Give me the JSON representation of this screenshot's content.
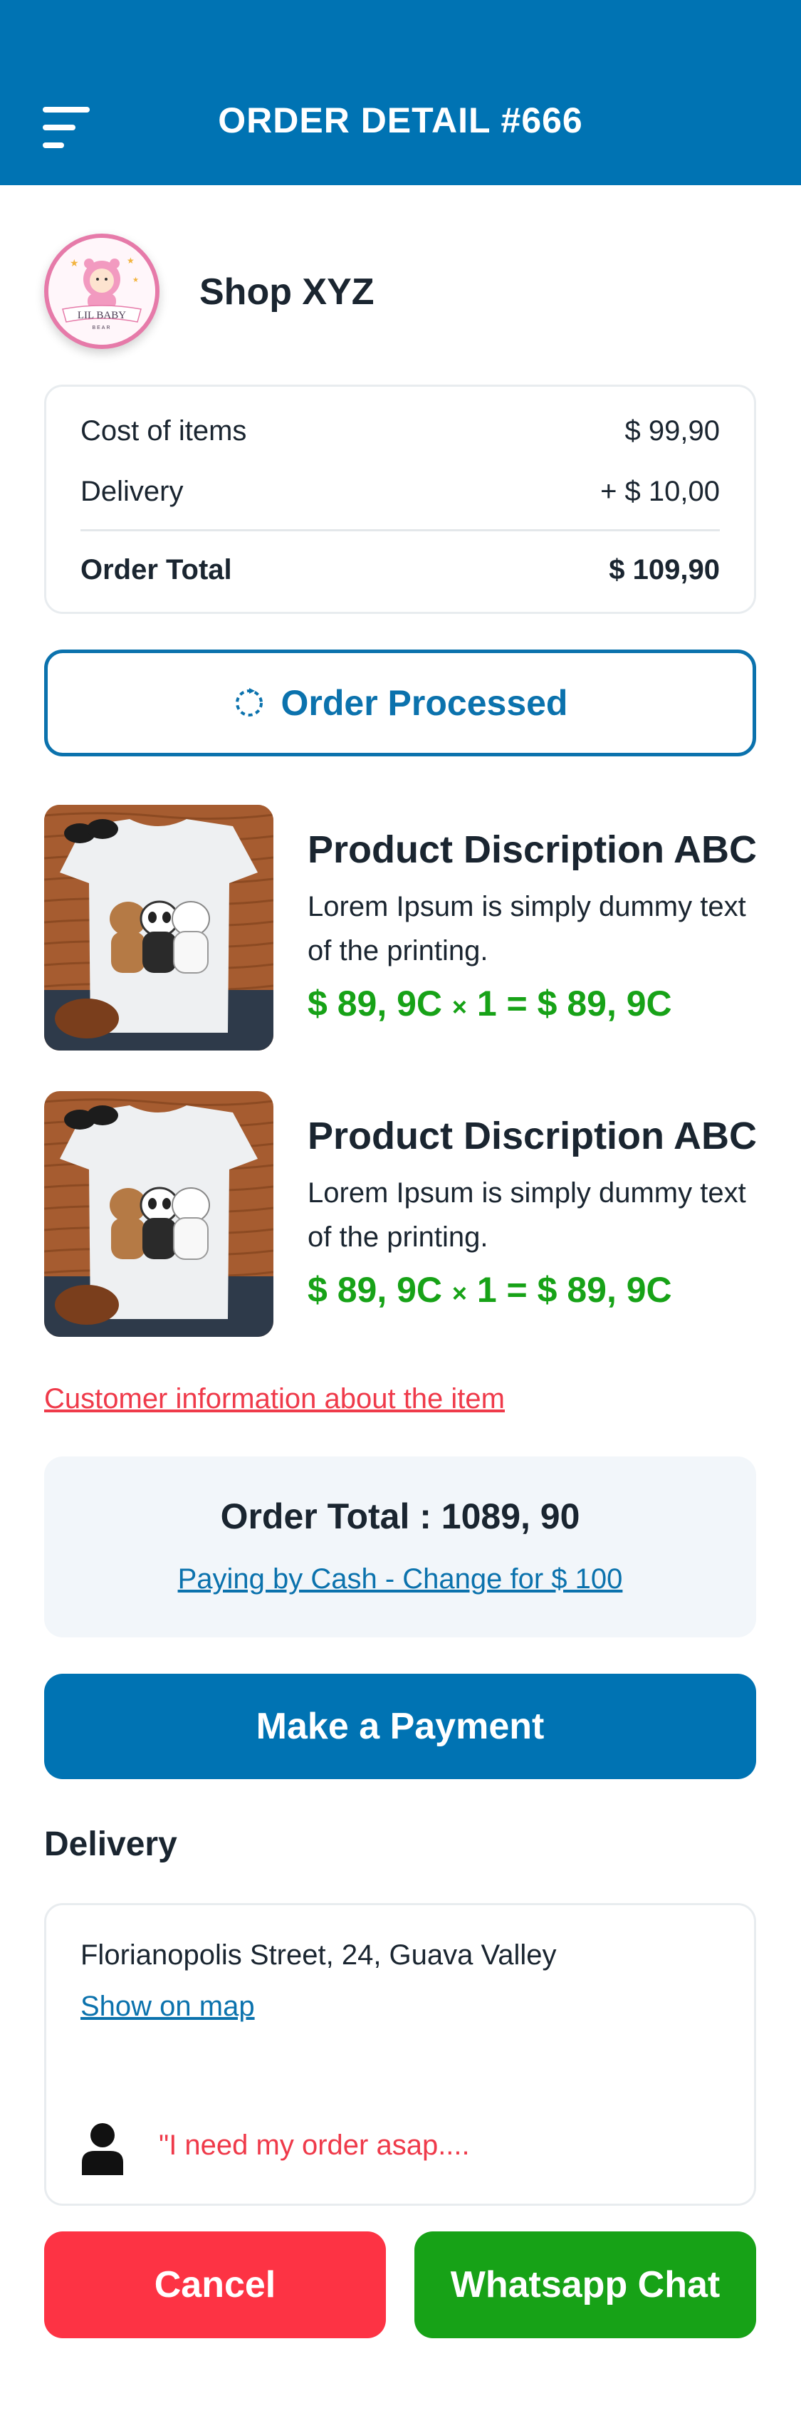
{
  "header": {
    "title": "ORDER DETAIL #666"
  },
  "shop": {
    "name": "Shop XYZ",
    "logo_text": "LIL BABY",
    "logo_subtext": "BEAR"
  },
  "costs": {
    "items_label": "Cost of items",
    "items_value": "$ 99,90",
    "delivery_label": "Delivery",
    "delivery_value": "+ $ 10,00",
    "total_label": "Order Total",
    "total_value": "$ 109,90"
  },
  "status": {
    "label": "Order Processed"
  },
  "products": [
    {
      "title": "Product Discription ABC",
      "description": "Lorem Ipsum is simply dummy text of the printing.",
      "price": "$ 89, 9C",
      "multiply": "×",
      "qty_total": "1 = $ 89, 9C"
    },
    {
      "title": "Product Discription ABC",
      "description": "Lorem Ipsum is simply dummy text of the printing.",
      "price": "$ 89, 9C",
      "multiply": "×",
      "qty_total": "1 = $ 89, 9C"
    }
  ],
  "customer_info_link": "Customer information about the item ",
  "summary": {
    "total": "Order Total : 1089, 90",
    "payment_note": "Paying by Cash - Change for $ 100"
  },
  "payment_button": "Make a Payment",
  "delivery": {
    "heading": "Delivery",
    "address": "Florianopolis Street, 24, Guava Valley",
    "map_link": "Show on map",
    "note": "\"I need my order asap...."
  },
  "actions": {
    "cancel": "Cancel",
    "whatsapp": "Whatsapp Chat"
  },
  "colors": {
    "primary": "#0073b3",
    "accent_red": "#fd3344",
    "accent_green": "#17a217",
    "text_dark": "#1a2530",
    "summary_bg": "#f2f6fa"
  },
  "icons": [
    "menu-icon",
    "refresh-icon",
    "user-icon"
  ]
}
